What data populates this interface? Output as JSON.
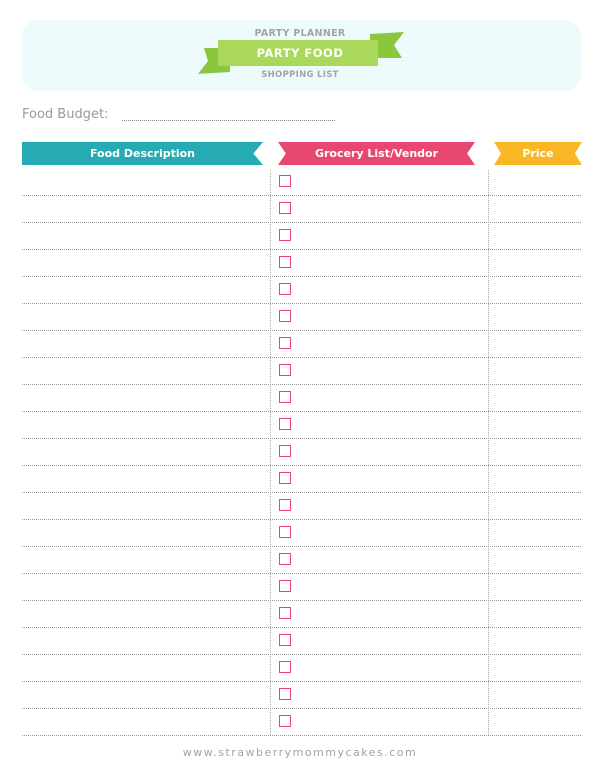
{
  "header": {
    "subtitle_top": "PARTY PLANNER",
    "banner_title": "PARTY FOOD",
    "subtitle_bottom": "SHOPPING LIST",
    "banner_color": "#a9d85b"
  },
  "budget": {
    "label": "Food Budget:"
  },
  "columns": {
    "description": {
      "label": "Food Description",
      "color": "#26aab3"
    },
    "grocery": {
      "label": "Grocery List/Vendor",
      "color": "#e84770"
    },
    "price": {
      "label": "Price",
      "color": "#f9b726"
    }
  },
  "rows": {
    "count": 21,
    "checkbox_color": "#e84770"
  },
  "footer": {
    "url": "www.strawberrymommycakes.com"
  }
}
